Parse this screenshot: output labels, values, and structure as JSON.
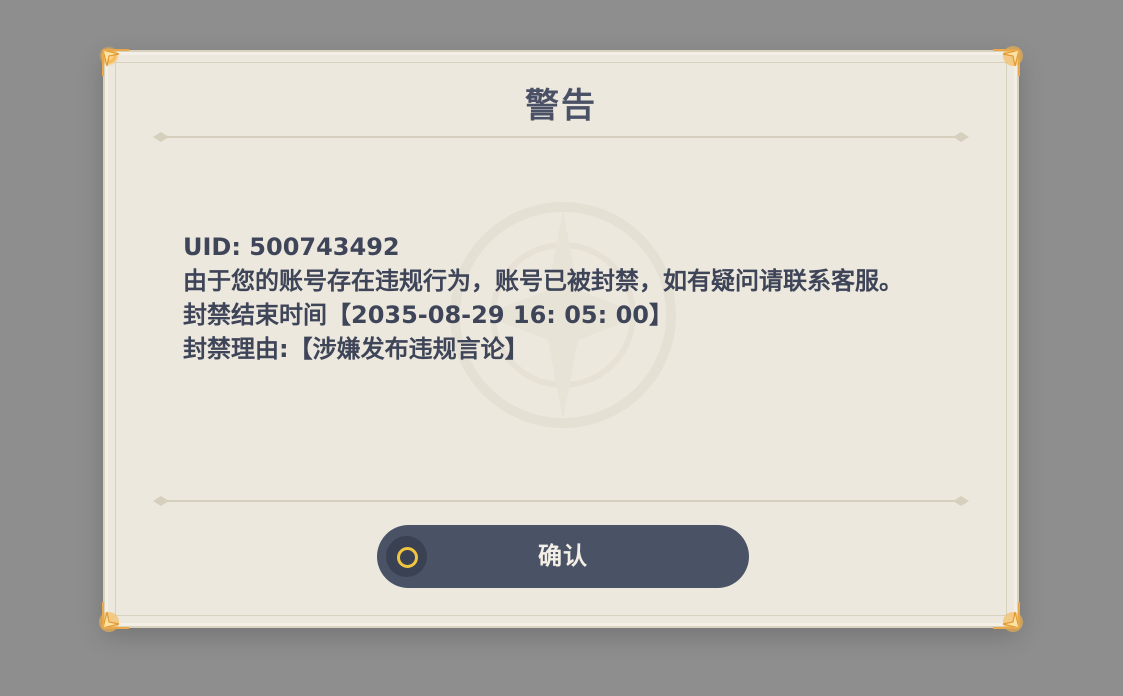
{
  "dialog": {
    "title": "警告",
    "uid_line": "UID: 500743492",
    "message_line": "由于您的账号存在违规行为，账号已被封禁，如有疑问请联系客服。",
    "ban_end_line": "封禁结束时间【2035-08-29 16: 05: 00】",
    "ban_reason_line": "封禁理由:【涉嫌发布违规言论】",
    "confirm_label": "确认",
    "confirm_icon": "circle-icon"
  },
  "colors": {
    "background": "#8e8e8e",
    "dialog_bg": "#ece8de",
    "text": "#3f4558",
    "button_bg": "#4a5266",
    "button_text": "#f3efe6",
    "accent_ring": "#f0c540",
    "corner_glow": "#f7b64a"
  }
}
